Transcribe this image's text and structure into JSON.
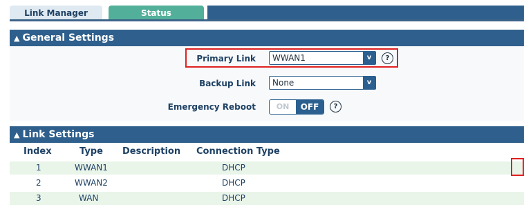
{
  "tabs": [
    {
      "label": "Link Manager",
      "active": true
    },
    {
      "label": "Status",
      "active": false
    }
  ],
  "general": {
    "title": "General Settings",
    "primary_link": {
      "label": "Primary Link",
      "value": "WWAN1"
    },
    "backup_link": {
      "label": "Backup Link",
      "value": "None"
    },
    "emergency_reboot": {
      "label": "Emergency Reboot",
      "on_label": "ON",
      "off_label": "OFF",
      "state": "OFF"
    }
  },
  "link_settings": {
    "title": "Link Settings",
    "columns": [
      "Index",
      "Type",
      "Description",
      "Connection Type"
    ],
    "rows": [
      {
        "index": "1",
        "type": "WWAN1",
        "description": "",
        "connection": "DHCP"
      },
      {
        "index": "2",
        "type": "WWAN2",
        "description": "",
        "connection": "DHCP"
      },
      {
        "index": "3",
        "type": "WAN",
        "description": "",
        "connection": "DHCP"
      }
    ]
  },
  "colors": {
    "header": "#2f5f8c",
    "tab_active": "#dfe9f1",
    "tab_status": "#52b09a",
    "highlight": "#e02020",
    "row_alt": "#eaf5ea"
  },
  "icons": {
    "collapse": "chevron-up-icon",
    "help": "question-circle-icon",
    "edit": "edit-icon"
  }
}
